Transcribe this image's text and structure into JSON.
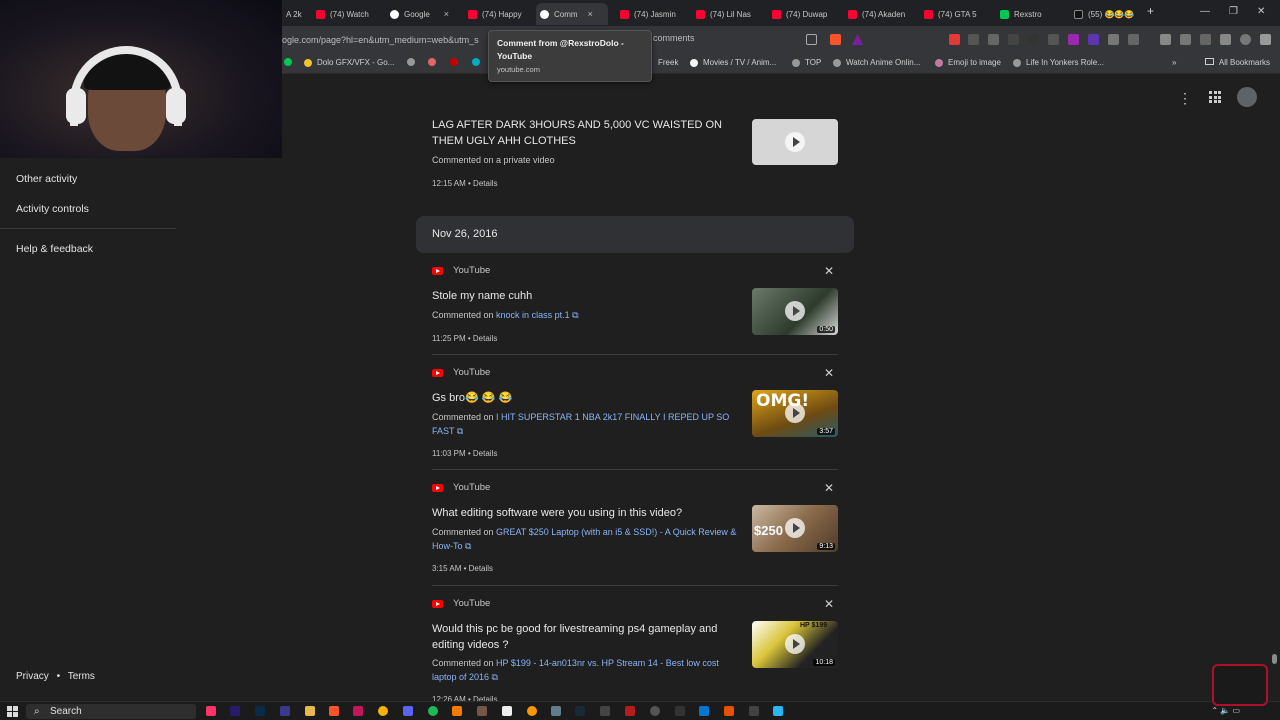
{
  "browser": {
    "tabs": [
      {
        "label": "A 2k",
        "icon": "none"
      },
      {
        "label": "(74) Watch",
        "icon": "yt"
      },
      {
        "label": "Google",
        "icon": "g",
        "close": "×"
      },
      {
        "label": "(74) Happy",
        "icon": "yt"
      },
      {
        "label": "Comm",
        "icon": "g",
        "active": true,
        "close": "×"
      },
      {
        "label": "(74) Jasmin",
        "icon": "yt"
      },
      {
        "label": "(74) Lil Nas",
        "icon": "yt"
      },
      {
        "label": "(74) Duwap",
        "icon": "yt"
      },
      {
        "label": "(74) Akaden",
        "icon": "yt"
      },
      {
        "label": "(74) GTA 5",
        "icon": "yt"
      },
      {
        "label": "Rexstro",
        "icon": "green"
      },
      {
        "label": "(55) 😂😂😂",
        "icon": "tt"
      }
    ],
    "new_tab": "+",
    "window_controls": {
      "minimize": "—",
      "restore": "❐",
      "close": "✕"
    },
    "address": "ogle.com/page?hl=en&utm_medium=web&utm_s",
    "address_suffix": "comments",
    "bookmarks": [
      {
        "label": "Dolo GFX/VFX - Go...",
        "color": "#f1c232"
      },
      {
        "label": "Freek",
        "color": "#888888"
      },
      {
        "label": "Movies / TV / Anim...",
        "color": "#111111"
      },
      {
        "label": "TOP",
        "color": "#888888"
      },
      {
        "label": "Watch Anime Onlin...",
        "color": "#888888"
      },
      {
        "label": "Emoji to image",
        "color": "#c27ba0"
      },
      {
        "label": "Life In Yonkers Role...",
        "color": "#888888"
      }
    ],
    "bookmarks_overflow": "»",
    "all_bookmarks": "All Bookmarks"
  },
  "tooltip": {
    "title": "Comment from @RexstroDolo - YouTube",
    "url": "youtube.com"
  },
  "sidebar": {
    "items": [
      "Other activity",
      "Activity controls",
      "Help & feedback"
    ],
    "footer": {
      "privacy": "Privacy",
      "sep": "•",
      "terms": "Terms"
    }
  },
  "header_icons": {
    "menu": "⋮",
    "apps": "⋮⋮⋮"
  },
  "top_item": {
    "title": "LAG AFTER DARK 3HOURS AND 5,000 VC WAISTED ON THEM UGLY AHH CLOTHES",
    "sub": "Commented on a private video",
    "time": "12:15 AM • Details"
  },
  "date_header": "Nov 26, 2016",
  "items": [
    {
      "source": "YouTube",
      "title": "Stole my name cuhh",
      "prefix": "Commented on ",
      "link": "knock in class pt.1 ⧉",
      "time": "11:25 PM • Details",
      "duration": "0:50",
      "thumb_color": "#3b4a3a"
    },
    {
      "source": "YouTube",
      "title": "Gs bro😂 😂 😂",
      "prefix": "Commented on ",
      "link": "I HIT SUPERSTAR 1 NBA 2k17 FINALLY I REPED UP SO FAST ⧉",
      "time": "11:03 PM • Details",
      "duration": "3:57",
      "thumb_color": "#b8860b",
      "thumb_text": "OMG!"
    },
    {
      "source": "YouTube",
      "title": "What editing software were you using in this video?",
      "prefix": "Commented on ",
      "link": "GREAT $250 Laptop (with an i5 & SSD!) - A Quick Review & How-To ⧉",
      "time": "3:15 AM • Details",
      "duration": "9:13",
      "thumb_color": "#8a6a4a",
      "thumb_text": "$250"
    },
    {
      "source": "YouTube",
      "title": "Would this pc be good for livestreaming ps4 gameplay and editing videos ?",
      "prefix": "Commented on ",
      "link": "HP $199 - 14-an013nr vs. HP Stream 14 - Best low cost laptop of 2016 ⧉",
      "time": "12:26 AM • Details",
      "duration": "10:18",
      "thumb_color": "#d9c43a",
      "thumb_text": "HP $199"
    }
  ],
  "close_glyph": "✕",
  "taskbar": {
    "search": "Search"
  },
  "colors": {
    "link": "#8ab4f8",
    "youtube_red": "#ff0000",
    "background": "#1f1f1f"
  }
}
